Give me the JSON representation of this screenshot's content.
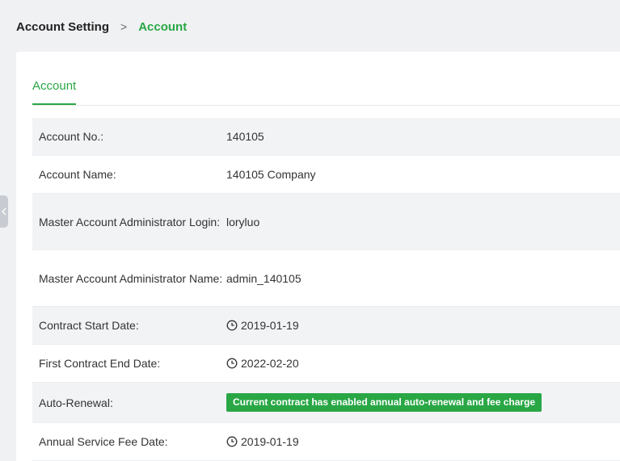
{
  "breadcrumb": {
    "parent": "Account Setting",
    "separator": ">",
    "current": "Account"
  },
  "tabs": [
    {
      "label": "Account",
      "active": true
    }
  ],
  "account_info": [
    {
      "label": "Account No.:",
      "value": "140105"
    },
    {
      "label": "Account Name:",
      "value": "140105 Company"
    },
    {
      "label": "Master Account Administrator Login:",
      "value": "loryluo"
    },
    {
      "label": "Master Account Administrator Name:",
      "value": "admin_140105"
    },
    {
      "label": "Contract Start Date:",
      "value": "2019-01-19",
      "icon": "clock-icon"
    },
    {
      "label": "First Contract End Date:",
      "value": "2022-02-20",
      "icon": "clock-icon"
    },
    {
      "label": "Auto-Renewal:",
      "badge": "Current contract has enabled annual auto-renewal and fee charge"
    },
    {
      "label": "Annual Service Fee Date:",
      "value": "2019-01-19",
      "icon": "clock-icon"
    }
  ],
  "colors": {
    "accent": "#29a745",
    "row_alt": "#f2f3f5",
    "page_bg": "#f0f1f3"
  }
}
